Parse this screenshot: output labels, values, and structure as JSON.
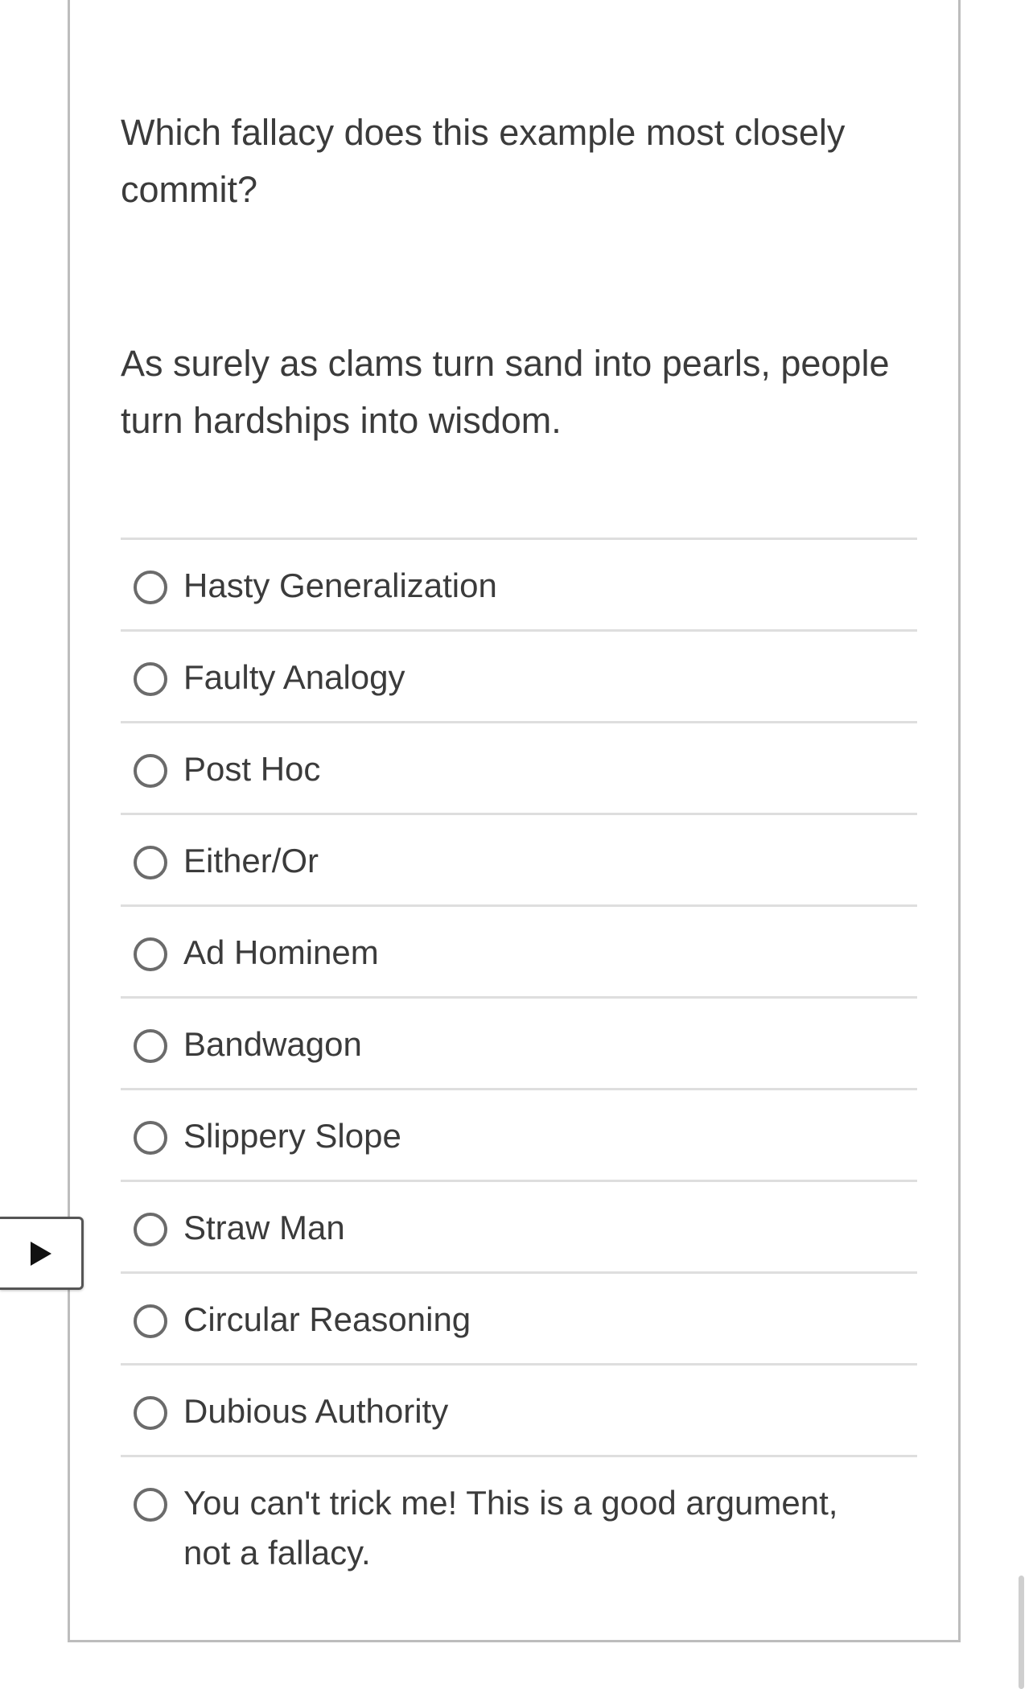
{
  "question": {
    "prompt": "Which fallacy does this example most closely commit?",
    "example": "As surely as clams turn sand into pearls, people turn hardships into wisdom."
  },
  "answers": [
    {
      "label": "Hasty Generalization"
    },
    {
      "label": "Faulty Analogy"
    },
    {
      "label": "Post Hoc"
    },
    {
      "label": "Either/Or"
    },
    {
      "label": "Ad Hominem"
    },
    {
      "label": "Bandwagon"
    },
    {
      "label": "Slippery Slope"
    },
    {
      "label": "Straw Man"
    },
    {
      "label": "Circular Reasoning"
    },
    {
      "label": "Dubious Authority"
    },
    {
      "label": "You can't trick me! This is a good argument, not a fallacy."
    }
  ],
  "side_toggle": {
    "icon": "play-triangle-icon"
  },
  "colors": {
    "text": "#3b3b3b",
    "border": "#bdbdbd",
    "divider": "#dedede",
    "radio": "#6b6b6b"
  }
}
